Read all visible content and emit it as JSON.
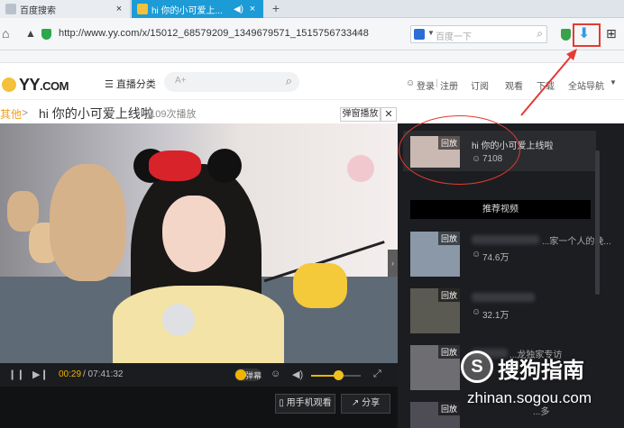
{
  "browser": {
    "tabs": [
      {
        "label": "百度搜索",
        "active": false
      },
      {
        "label": "hi 你的小可爱上...",
        "active": true
      }
    ],
    "new_tab_symbol": "+",
    "url": "http://www.yy.com/x/15012_68579209_1349679571_1515756733448",
    "search_placeholder": "百度一下"
  },
  "site_header": {
    "logo_text": "YY",
    "logo_suffix": ".COM",
    "category_menu": "直播分类",
    "search_placeholder": "A+",
    "links": {
      "login": "登录",
      "divider": "|",
      "register": "注册",
      "subscribe": "订阅",
      "watch": "观看",
      "download": "下载",
      "site_nav": "全站导航"
    }
  },
  "video_page": {
    "breadcrumb": "其他",
    "breadcrumb_sep": ">",
    "title": "hi 你的小可爱上线啦",
    "play_count": "7109次播放",
    "danmu_popup_btn": "弹窗播放",
    "close_symbol": "✕"
  },
  "player": {
    "current_time": "00:29",
    "total_time": "/ 07:41:32",
    "danmu_label": "弹幕",
    "volume_fraction": 0.55,
    "mobile_watch_btn": "用手机观看",
    "share_btn": "分享"
  },
  "sidebar": {
    "current": {
      "badge": "回放",
      "title": "hi 你的小可爱上线啦",
      "count": "7108"
    },
    "recommend_header": "推荐视频",
    "items": [
      {
        "badge": "回放",
        "title": "...家一个人的晚...",
        "count": "74.6万"
      },
      {
        "badge": "回放",
        "title": "",
        "count": "32.1万"
      },
      {
        "badge": "回放",
        "title": "...龙独家专访",
        "count": ""
      },
      {
        "badge": "回放",
        "title": "...多",
        "count": ""
      }
    ]
  },
  "watermark": {
    "logo_char": "S",
    "cn_text": "搜狗指南",
    "en_text": "zhinan.sogou.com"
  },
  "colors": {
    "tab_active": "#1c9bd6",
    "accent_orange": "#f0b400",
    "annotation_red": "#e43b32",
    "sidebar_bg": "#1c1d21"
  }
}
